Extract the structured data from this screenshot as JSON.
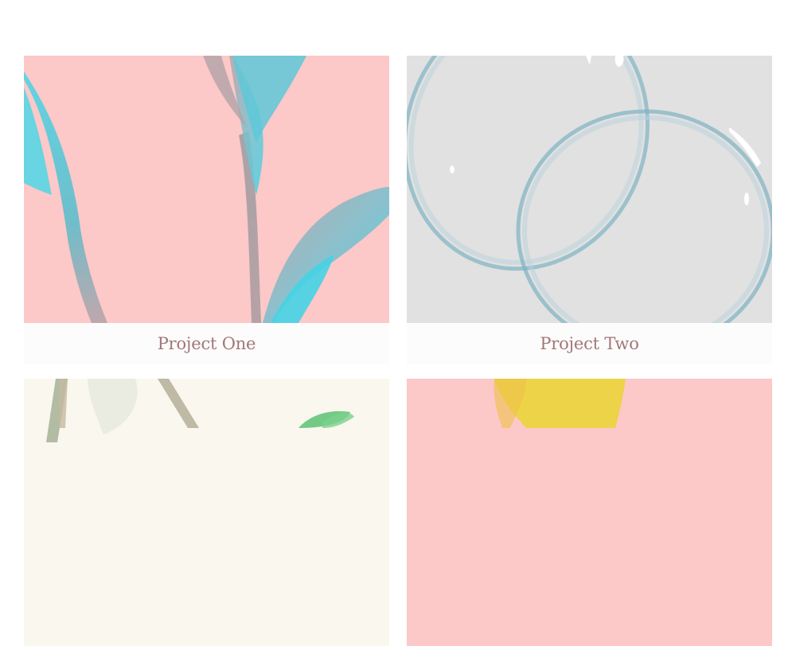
{
  "projects": [
    {
      "title": "Project One",
      "art": "pink-botanical-watercolor"
    },
    {
      "title": "Project Two",
      "art": "grey-bubbles-watercolor"
    },
    {
      "title": "",
      "art": "cream-green-watercolor"
    },
    {
      "title": "",
      "art": "pink-yellow-watercolor"
    }
  ],
  "colors": {
    "pink": "#fcc8c8",
    "grey": "#e1e1e1",
    "cream": "#f9f7ee",
    "cyan": "#4fd6e6",
    "title": "#a27778",
    "yellow": "#ead43a"
  }
}
